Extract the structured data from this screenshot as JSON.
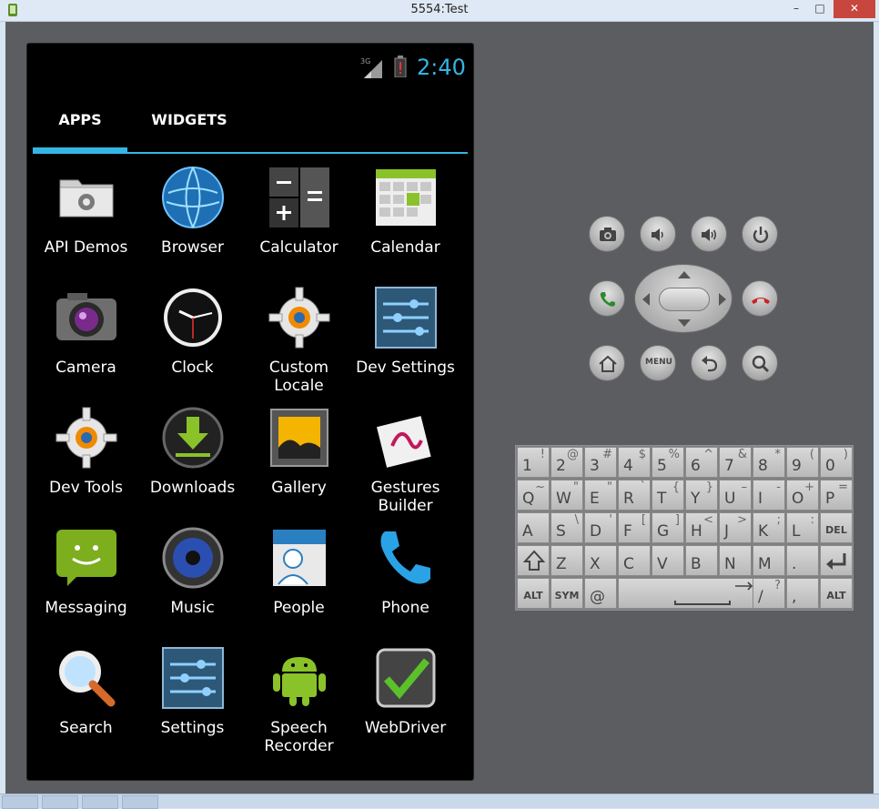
{
  "window": {
    "title": "5554:Test",
    "min": "–",
    "max": "□",
    "close": "✕"
  },
  "status": {
    "network": "3G",
    "time": "2:40"
  },
  "tabs": {
    "apps": "APPS",
    "widgets": "WIDGETS"
  },
  "apps": [
    {
      "label": "API Demos",
      "icon": "folder-gear-icon"
    },
    {
      "label": "Browser",
      "icon": "globe-icon"
    },
    {
      "label": "Calculator",
      "icon": "calculator-icon"
    },
    {
      "label": "Calendar",
      "icon": "calendar-icon"
    },
    {
      "label": "Camera",
      "icon": "camera-icon"
    },
    {
      "label": "Clock",
      "icon": "clock-icon"
    },
    {
      "label": "Custom\nLocale",
      "icon": "gear-icon"
    },
    {
      "label": "Dev Settings",
      "icon": "sliders-icon"
    },
    {
      "label": "Dev Tools",
      "icon": "gear-icon"
    },
    {
      "label": "Downloads",
      "icon": "download-icon"
    },
    {
      "label": "Gallery",
      "icon": "gallery-icon"
    },
    {
      "label": "Gestures\nBuilder",
      "icon": "gesture-icon"
    },
    {
      "label": "Messaging",
      "icon": "message-icon"
    },
    {
      "label": "Music",
      "icon": "speaker-icon"
    },
    {
      "label": "People",
      "icon": "contacts-icon"
    },
    {
      "label": "Phone",
      "icon": "phone-icon"
    },
    {
      "label": "Search",
      "icon": "magnifier-icon"
    },
    {
      "label": "Settings",
      "icon": "sliders-icon"
    },
    {
      "label": "Speech\nRecorder",
      "icon": "android-icon"
    },
    {
      "label": "WebDriver",
      "icon": "check-icon"
    }
  ],
  "controls": {
    "menu": "MENU"
  },
  "keyboard": {
    "row1": [
      [
        "1",
        "!"
      ],
      [
        "2",
        "@"
      ],
      [
        "3",
        "#"
      ],
      [
        "4",
        "$"
      ],
      [
        "5",
        "%"
      ],
      [
        "6",
        "^"
      ],
      [
        "7",
        "&"
      ],
      [
        "8",
        "*"
      ],
      [
        "9",
        "("
      ],
      [
        "0",
        ")"
      ]
    ],
    "row2": [
      [
        "Q",
        "~"
      ],
      [
        "W",
        "\""
      ],
      [
        "E",
        "\""
      ],
      [
        "R",
        "`"
      ],
      [
        "T",
        "{"
      ],
      [
        "Y",
        "}"
      ],
      [
        "U",
        "–"
      ],
      [
        "I",
        "-"
      ],
      [
        "O",
        "+"
      ],
      [
        "P",
        "="
      ]
    ],
    "row3": [
      [
        "A",
        ""
      ],
      [
        "S",
        "\\"
      ],
      [
        "D",
        "'"
      ],
      [
        "F",
        "["
      ],
      [
        "G",
        "]"
      ],
      [
        "H",
        "<"
      ],
      [
        "J",
        ">"
      ],
      [
        "K",
        ";"
      ],
      [
        "L",
        ":"
      ]
    ],
    "row4": [
      [
        "Z",
        ""
      ],
      [
        "X",
        ""
      ],
      [
        "C",
        ""
      ],
      [
        "V",
        ""
      ],
      [
        "B",
        ""
      ],
      [
        "N",
        ""
      ],
      [
        "M",
        ""
      ],
      [
        ".",
        ""
      ]
    ],
    "del": "DEL",
    "alt": "ALT",
    "sym": "SYM",
    "at": "@",
    "slash": "/",
    "question": "?",
    "comma": ","
  }
}
